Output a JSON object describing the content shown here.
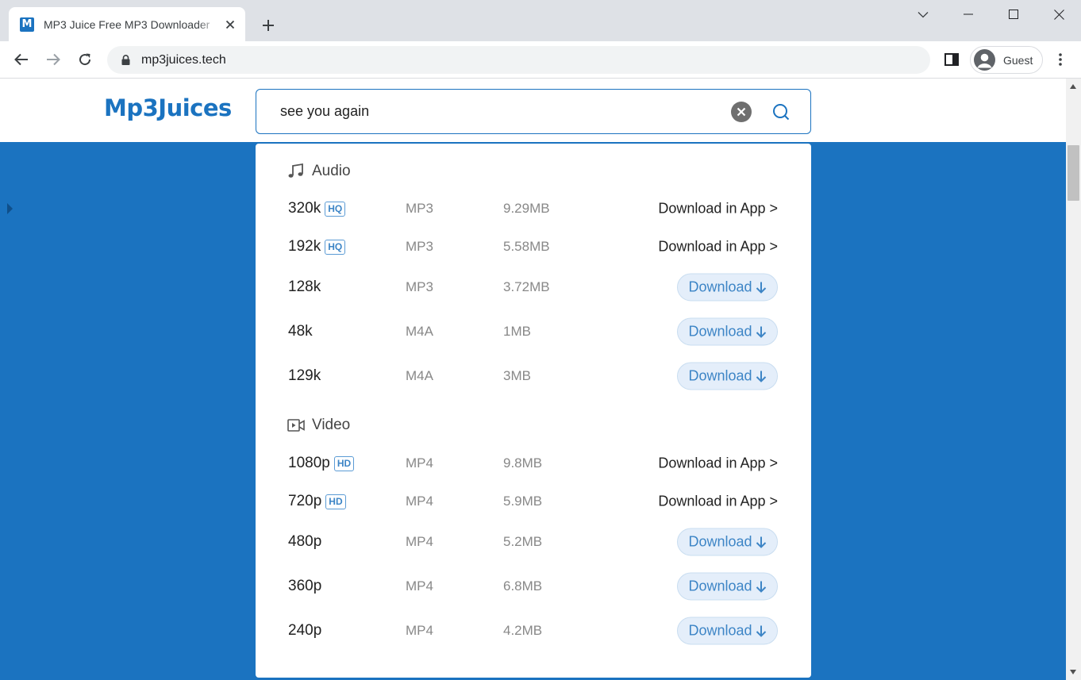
{
  "browser": {
    "tab_title": "MP3 Juice Free MP3 Downloader",
    "favicon_letter": "M",
    "url": "mp3juices.tech",
    "profile_label": "Guest"
  },
  "site": {
    "logo": "Mp3Juices",
    "search_value": "see you again",
    "accent_color": "#1b73c0"
  },
  "audio": {
    "heading": "Audio",
    "rows": [
      {
        "quality": "320k",
        "badge": "HQ",
        "format": "MP3",
        "size": "9.29MB",
        "action": "Download in App >"
      },
      {
        "quality": "192k",
        "badge": "HQ",
        "format": "MP3",
        "size": "5.58MB",
        "action": "Download in App >"
      },
      {
        "quality": "128k",
        "badge": "",
        "format": "MP3",
        "size": "3.72MB",
        "action": "Download"
      },
      {
        "quality": "48k",
        "badge": "",
        "format": "M4A",
        "size": "1MB",
        "action": "Download"
      },
      {
        "quality": "129k",
        "badge": "",
        "format": "M4A",
        "size": "3MB",
        "action": "Download"
      }
    ]
  },
  "video": {
    "heading": "Video",
    "rows": [
      {
        "quality": "1080p",
        "badge": "HD",
        "format": "MP4",
        "size": "9.8MB",
        "action": "Download in App >"
      },
      {
        "quality": "720p",
        "badge": "HD",
        "format": "MP4",
        "size": "5.9MB",
        "action": "Download in App >"
      },
      {
        "quality": "480p",
        "badge": "",
        "format": "MP4",
        "size": "5.2MB",
        "action": "Download"
      },
      {
        "quality": "360p",
        "badge": "",
        "format": "MP4",
        "size": "6.8MB",
        "action": "Download"
      },
      {
        "quality": "240p",
        "badge": "",
        "format": "MP4",
        "size": "4.2MB",
        "action": "Download"
      }
    ]
  }
}
